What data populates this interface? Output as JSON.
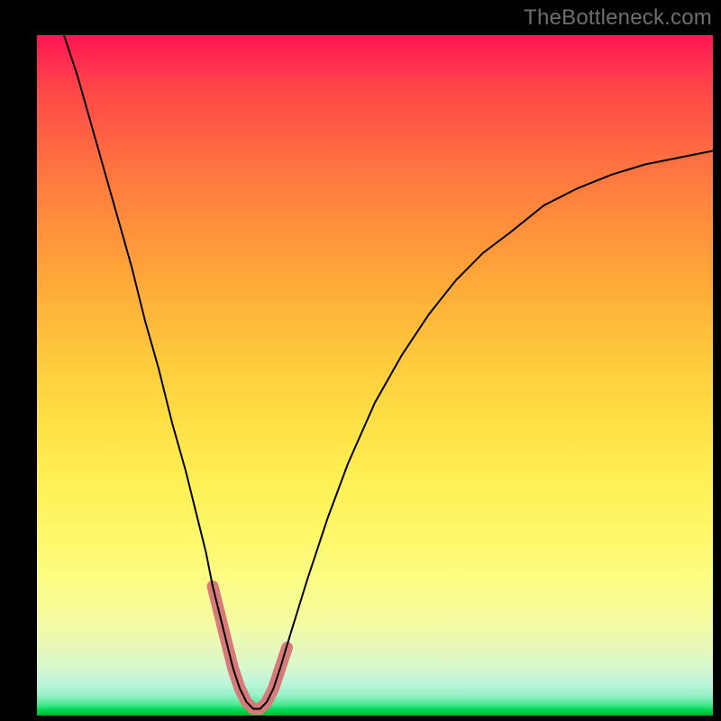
{
  "watermark": "TheBottleneck.com",
  "chart_data": {
    "type": "line",
    "title": "",
    "xlabel": "",
    "ylabel": "",
    "xlim": [
      0,
      100
    ],
    "ylim": [
      0,
      100
    ],
    "grid": false,
    "annotations": [],
    "series": [
      {
        "name": "black-curve",
        "color": "#000000",
        "stroke_width": 2,
        "x": [
          4,
          6,
          8,
          10,
          12,
          14,
          16,
          18,
          20,
          22,
          24,
          25,
          26,
          27,
          28,
          29,
          30,
          31,
          32,
          33,
          34,
          35,
          36,
          37.5,
          40,
          43,
          46,
          50,
          54,
          58,
          62,
          66,
          70,
          75,
          80,
          85,
          90,
          95,
          100
        ],
        "values": [
          100,
          94,
          87,
          80,
          73,
          66,
          58,
          51,
          43,
          36,
          28,
          24,
          19,
          15,
          11,
          7,
          4,
          2,
          1,
          1,
          2,
          4,
          7,
          12,
          20,
          29,
          37,
          46,
          53,
          59,
          64,
          68,
          71,
          75,
          77.5,
          79.5,
          81,
          82,
          83
        ]
      },
      {
        "name": "pink-highlight",
        "color": "#d77a7a",
        "stroke_width": 13,
        "linecap": "round",
        "x": [
          26,
          27,
          28,
          29,
          30,
          31,
          32,
          33,
          34,
          35,
          36,
          37
        ],
        "values": [
          19,
          15,
          11,
          7,
          4,
          2,
          1,
          1,
          2,
          4,
          7,
          10
        ]
      }
    ],
    "background_gradient": {
      "direction": "vertical",
      "stops": [
        {
          "pos": 0.0,
          "color": "#ff1552"
        },
        {
          "pos": 0.5,
          "color": "#ffcb3d"
        },
        {
          "pos": 0.8,
          "color": "#fcfc84"
        },
        {
          "pos": 0.97,
          "color": "#98f1c9"
        },
        {
          "pos": 1.0,
          "color": "#00b41b"
        }
      ]
    }
  }
}
